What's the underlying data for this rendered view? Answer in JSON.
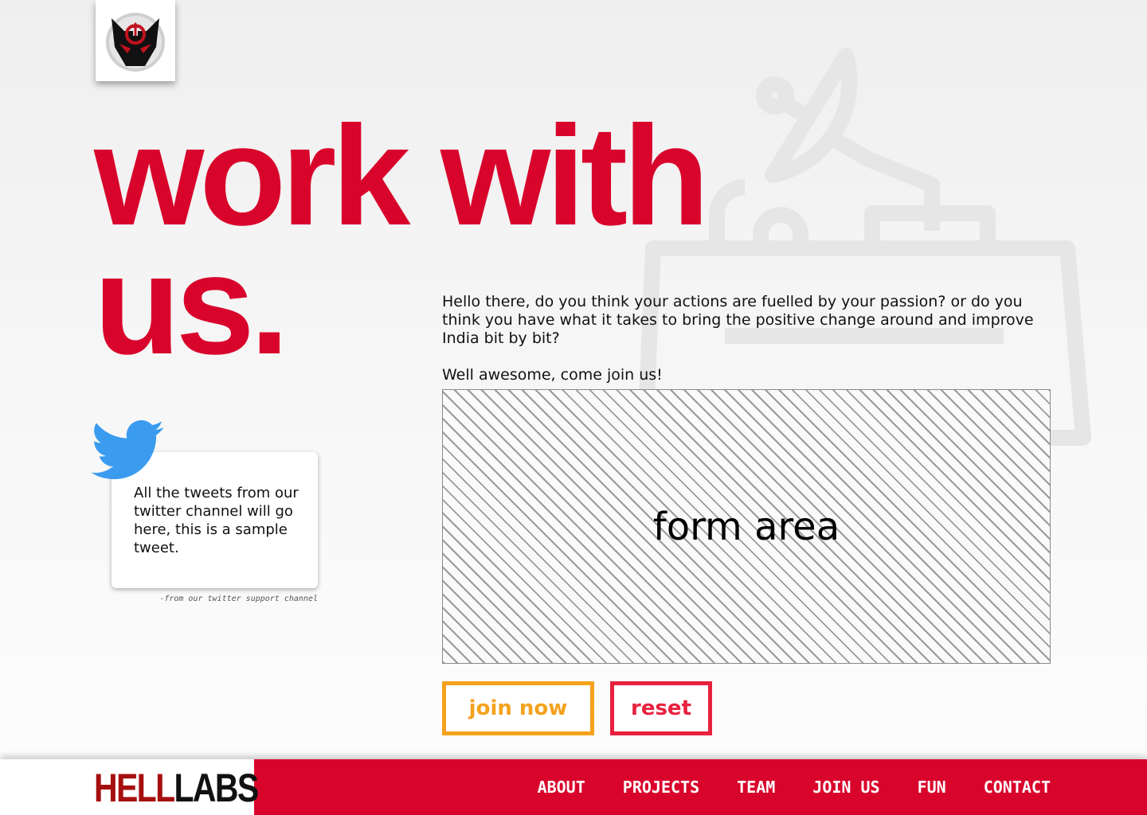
{
  "header": {
    "logo_icon": "helllabs-mascot-icon",
    "headline_line1": "work with",
    "headline_line2": "us."
  },
  "intro": {
    "paragraph1": "Hello there, do you think your actions are fuelled by your passion? or do you think you have what it takes to bring the positive change around and improve India bit by bit?",
    "paragraph2": "Well awesome, come join us!"
  },
  "form": {
    "placeholder_label": "form area"
  },
  "buttons": {
    "join_label": "join now",
    "reset_label": "reset"
  },
  "tweet": {
    "icon": "twitter-bird-icon",
    "text": "All the tweets from our twitter channel will go here, this is a sample tweet.",
    "source": "-from our twitter support channel"
  },
  "footer": {
    "brand_part1": "HELL",
    "brand_part2": "LABS",
    "nav": [
      "ABOUT",
      "PROJECTS",
      "TEAM",
      "JOIN US",
      "FUN",
      "CONTACT"
    ]
  },
  "colors": {
    "brand_red": "#d9042b",
    "join_orange": "#f4a21d",
    "reset_red": "#e8213e",
    "twitter_blue": "#3a9bef"
  }
}
